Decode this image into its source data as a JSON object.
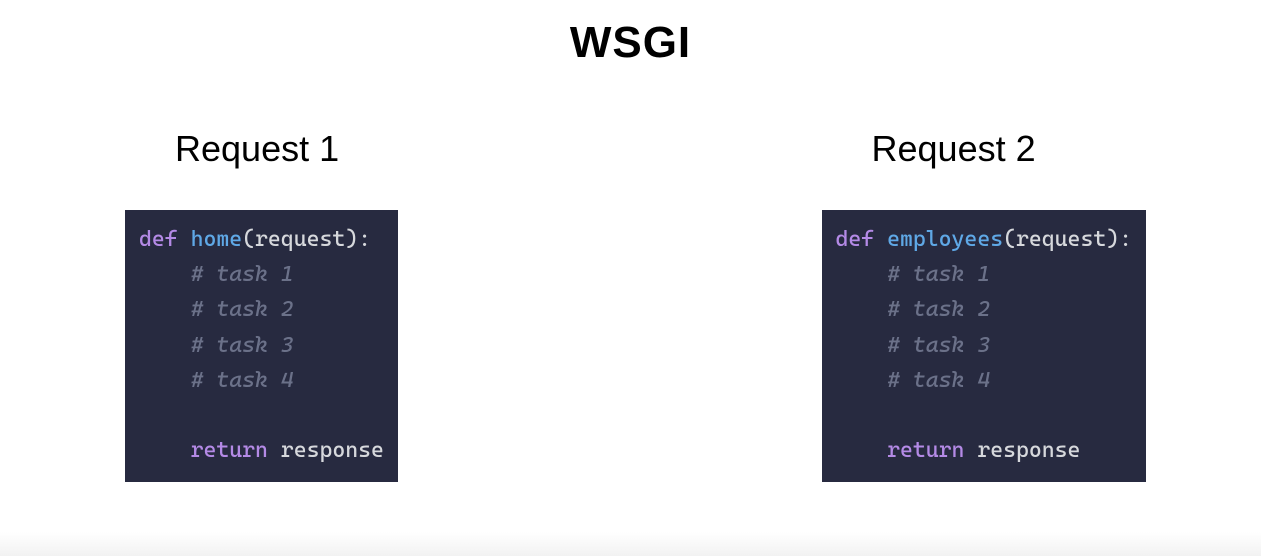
{
  "title": "WSGI",
  "columns": [
    {
      "label": "Request 1",
      "code": {
        "keyword_def": "def",
        "func_name": "home",
        "paren_open": "(",
        "param": "request",
        "paren_close_colon": "):",
        "comments": [
          "# task 1",
          "# task 2",
          "# task 3",
          "# task 4"
        ],
        "keyword_return": "return",
        "return_ident": "response"
      }
    },
    {
      "label": "Request 2",
      "code": {
        "keyword_def": "def",
        "func_name": "employees",
        "paren_open": "(",
        "param": "request",
        "paren_close_colon": "):",
        "comments": [
          "# task 1",
          "# task 2",
          "# task 3",
          "# task 4"
        ],
        "keyword_return": "return",
        "return_ident": "response"
      }
    }
  ]
}
